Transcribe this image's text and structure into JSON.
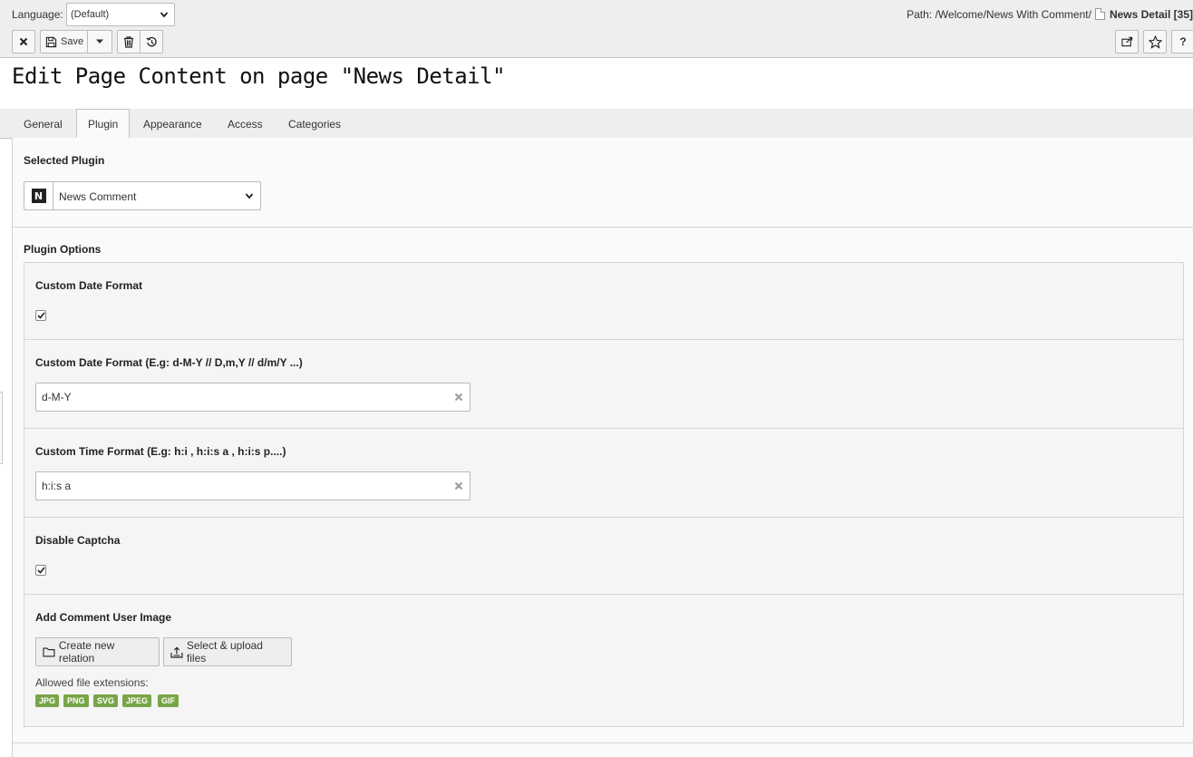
{
  "header": {
    "language_label": "Language:",
    "language_value": "(Default)",
    "path_prefix": "Path: /Welcome/News With Comment/",
    "path_current": "News Detail [35]",
    "save_label": "Save"
  },
  "page_title": "Edit Page Content on page \"News Detail\"",
  "tabs": [
    {
      "label": "General",
      "active": false
    },
    {
      "label": "Plugin",
      "active": true
    },
    {
      "label": "Appearance",
      "active": false
    },
    {
      "label": "Access",
      "active": false
    },
    {
      "label": "Categories",
      "active": false
    }
  ],
  "plugin": {
    "selected_label": "Selected Plugin",
    "selected_value": "News Comment",
    "icon_letter": "N",
    "options_label": "Plugin Options"
  },
  "fields": {
    "custom_date_format": {
      "label": "Custom Date Format",
      "checked": true
    },
    "date_format_input": {
      "label": "Custom Date Format (E.g: d-M-Y // D,m,Y // d/m/Y ...)",
      "value": "d-M-Y"
    },
    "time_format_input": {
      "label": "Custom Time Format (E.g: h:i , h:i:s a , h:i:s p....)",
      "value": "h:i:s a"
    },
    "disable_captcha": {
      "label": "Disable Captcha",
      "checked": true
    },
    "user_image": {
      "label": "Add Comment User Image",
      "create_relation": "Create new relation",
      "select_upload": "Select & upload files",
      "allowed_label": "Allowed file extensions:",
      "extensions": [
        "JPG",
        "PNG",
        "SVG",
        "JPEG",
        "GIF"
      ]
    }
  },
  "colors": {
    "header_bg": "#eeeeee",
    "content_bg": "#fafafa",
    "badge_green": "#79a548"
  }
}
